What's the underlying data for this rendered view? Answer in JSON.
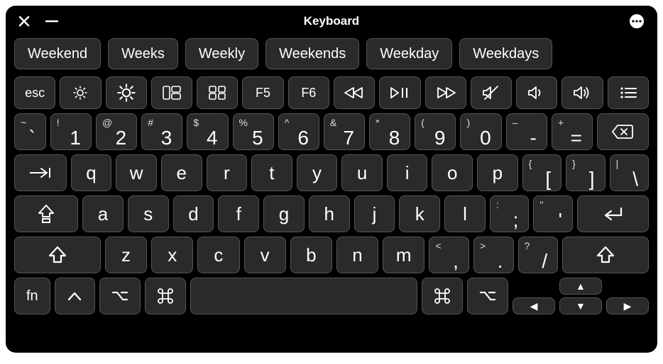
{
  "title": "Keyboard",
  "suggestions": [
    "Weekend",
    "Weeks",
    "Weekly",
    "Weekends",
    "Weekday",
    "Weekdays"
  ],
  "fn": {
    "esc": "esc",
    "f5": "F5",
    "f6": "F6"
  },
  "nums": {
    "r0": {
      "sup": "~",
      "main": "`"
    },
    "r1": {
      "sup": "!",
      "main": "1"
    },
    "r2": {
      "sup": "@",
      "main": "2"
    },
    "r3": {
      "sup": "#",
      "main": "3"
    },
    "r4": {
      "sup": "$",
      "main": "4"
    },
    "r5": {
      "sup": "%",
      "main": "5"
    },
    "r6": {
      "sup": "^",
      "main": "6"
    },
    "r7": {
      "sup": "&",
      "main": "7"
    },
    "r8": {
      "sup": "*",
      "main": "8"
    },
    "r9": {
      "sup": "(",
      "main": "9"
    },
    "r10": {
      "sup": ")",
      "main": "0"
    },
    "r11": {
      "sup": "–",
      "main": "-"
    },
    "r12": {
      "sup": "+",
      "main": "="
    }
  },
  "row_q": {
    "k0": "q",
    "k1": "w",
    "k2": "e",
    "k3": "r",
    "k4": "t",
    "k5": "y",
    "k6": "u",
    "k7": "i",
    "k8": "o",
    "k9": "p"
  },
  "brackets": {
    "lb_sup": "{",
    "lb": "[",
    "rb_sup": "}",
    "rb": "]",
    "bs_sup": "|",
    "bs": "\\"
  },
  "row_a": {
    "k0": "a",
    "k1": "s",
    "k2": "d",
    "k3": "f",
    "k4": "g",
    "k5": "h",
    "k6": "j",
    "k7": "k",
    "k8": "l"
  },
  "punct_a": {
    "semi_sup": ":",
    "semi": ";",
    "quote_sup": "\"",
    "quote": "'"
  },
  "row_z": {
    "k0": "z",
    "k1": "x",
    "k2": "c",
    "k3": "v",
    "k4": "b",
    "k5": "n",
    "k6": "m"
  },
  "punct_z": {
    "comma_sup": "<",
    "comma": ",",
    "dot_sup": ">",
    "dot": ".",
    "slash_sup": "?",
    "slash": "/"
  },
  "bottom": {
    "fn": "fn"
  },
  "arrows": {
    "up": "▲",
    "down": "▼",
    "left": "◀",
    "right": "▶"
  }
}
